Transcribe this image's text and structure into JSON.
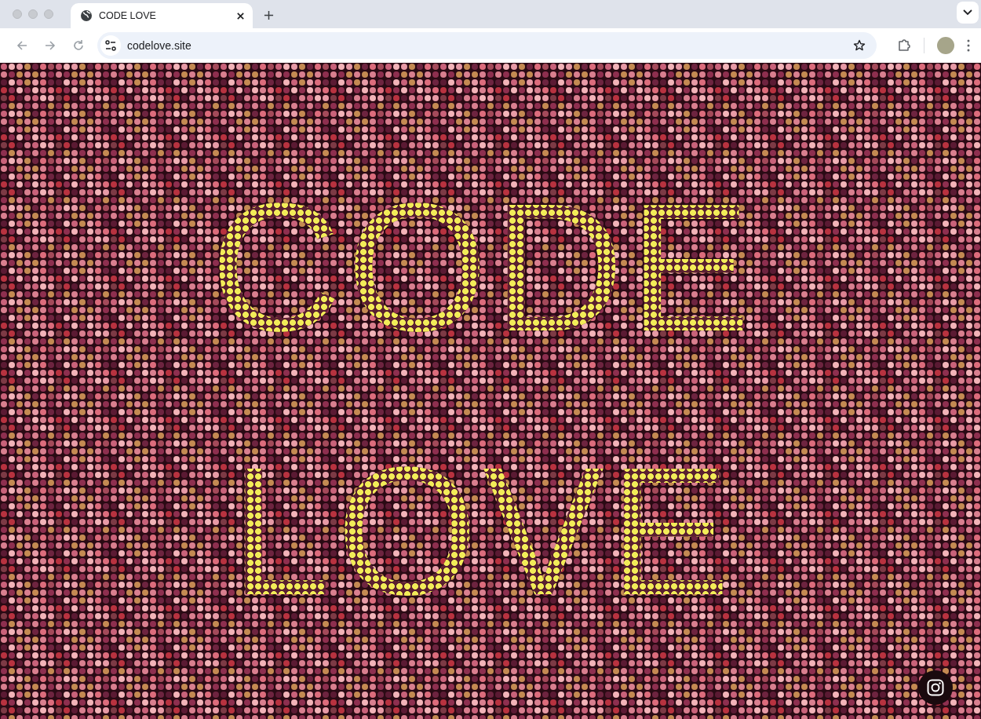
{
  "browser": {
    "tabs": [
      {
        "title": "CODE LOVE",
        "selected": true
      }
    ],
    "url": "codelove.site"
  },
  "page": {
    "headline_lines": [
      "CODE",
      "LOVE"
    ]
  }
}
